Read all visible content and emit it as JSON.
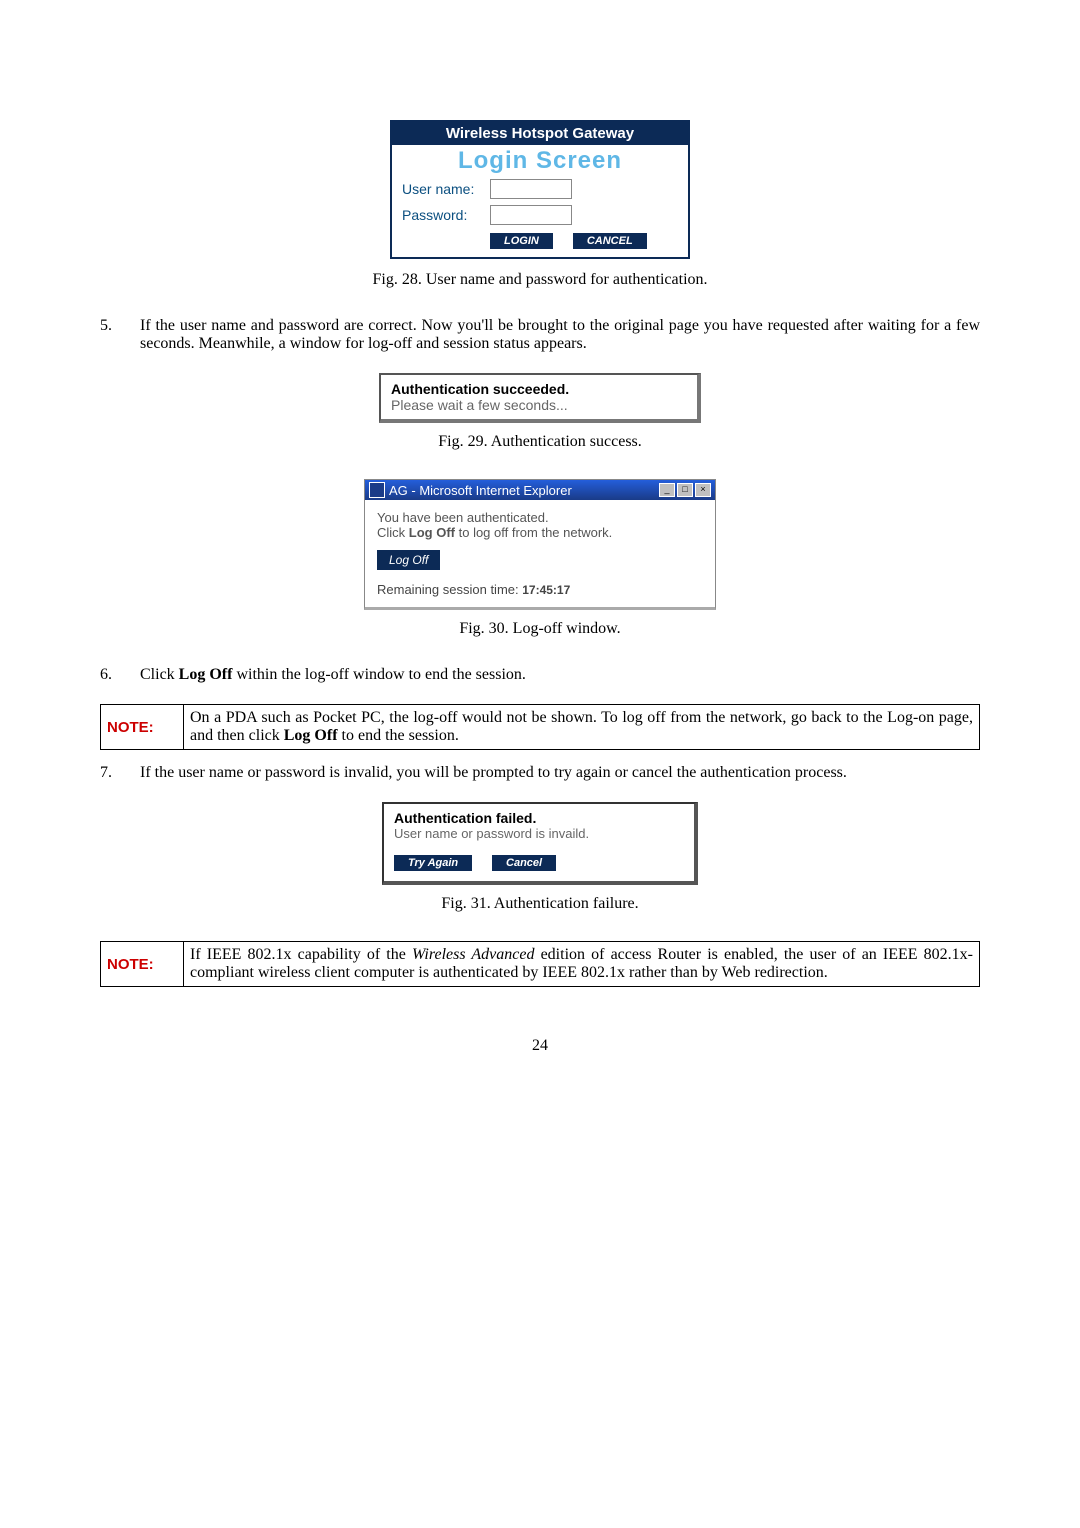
{
  "login": {
    "header1": "Wireless Hotspot Gateway",
    "header2": "Login  Screen",
    "username_label": "User name:",
    "password_label": "Password:",
    "login_btn": "LOGIN",
    "cancel_btn": "CANCEL"
  },
  "fig28": "Fig. 28. User name and password for authentication.",
  "step5": {
    "num": "5.",
    "text": "If the user name and password are correct. Now you'll be brought to the original page you have requested after waiting for a few seconds. Meanwhile, a window for log-off and session status appears."
  },
  "succ": {
    "title": "Authentication succeeded.",
    "sub": "Please wait a few seconds..."
  },
  "fig29": "Fig. 29. Authentication success.",
  "ie": {
    "title": "AG - Microsoft Internet Explorer",
    "line1": "You have been authenticated.",
    "line2_a": "Click ",
    "line2_b": "Log Off",
    "line2_c": " to log off from the network.",
    "logoff_btn": "Log Off",
    "status_label": "Remaining session time:  ",
    "status_time": "17:45:17",
    "min_btn": "_",
    "max_btn": "□",
    "close_btn": "×"
  },
  "fig30": "Fig. 30. Log-off window.",
  "step6": {
    "num": "6.",
    "text_a": "Click ",
    "text_b": "Log Off",
    "text_c": " within the log-off window to end the session."
  },
  "note1": {
    "label": "NOTE:",
    "text_a": "On a PDA such as Pocket PC, the log-off would not be shown. To log off from the network, go back to the Log-on page, and then click ",
    "text_b": "Log Off",
    "text_c": " to end the session."
  },
  "step7": {
    "num": "7.",
    "text": "If the user name or password is invalid, you will be prompted to try again or cancel the authentication process."
  },
  "fail": {
    "title": "Authentication failed.",
    "sub": "User name or password is invaild.",
    "try_btn": "Try Again",
    "cancel_btn": "Cancel"
  },
  "fig31": "Fig. 31. Authentication failure.",
  "note2": {
    "label": "NOTE:",
    "text_a": "If IEEE 802.1x capability of the ",
    "text_b": "Wireless Advanced",
    "text_c": " edition of access Router is enabled, the user of an IEEE 802.1x-compliant wireless client computer is authenticated by IEEE 802.1x rather than by Web redirection."
  },
  "page_number": "24"
}
